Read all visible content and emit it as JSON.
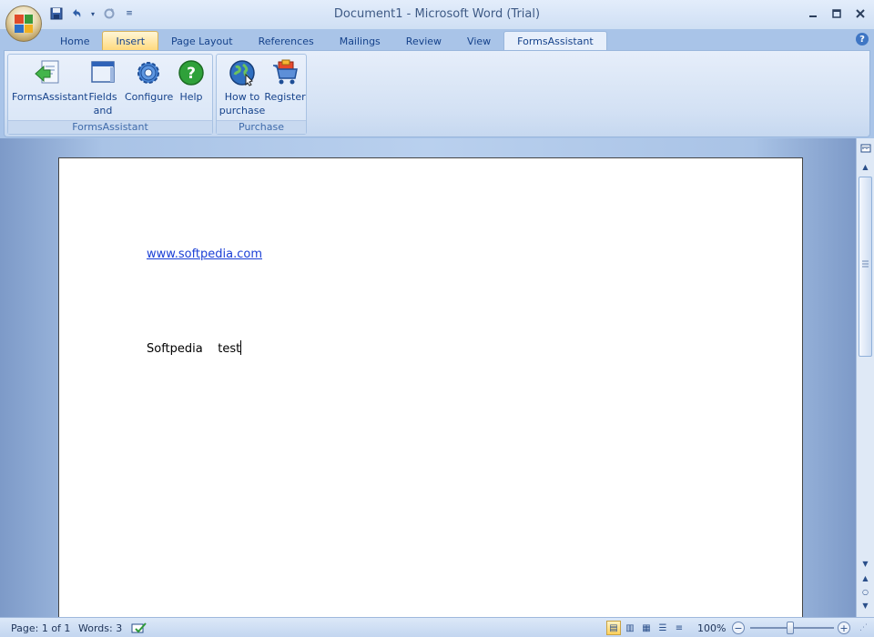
{
  "window": {
    "document_name": "Document1",
    "separator": "-",
    "app_name": "Microsoft Word (Trial)"
  },
  "quick_access": {
    "icons": [
      "save-icon",
      "undo-icon",
      "redo-icon",
      "customize-icon"
    ]
  },
  "tabs": [
    {
      "label": "Home"
    },
    {
      "label": "Insert"
    },
    {
      "label": "Page Layout"
    },
    {
      "label": "References"
    },
    {
      "label": "Mailings"
    },
    {
      "label": "Review"
    },
    {
      "label": "View"
    },
    {
      "label": "FormsAssistant"
    }
  ],
  "ribbon": {
    "groups": [
      {
        "label": "FormsAssistant",
        "buttons": [
          {
            "label": "FormsAssistant",
            "icon": "forms-assistant-icon"
          },
          {
            "label": "Fields and Clips",
            "icon": "fields-clips-icon"
          },
          {
            "label": "Configure",
            "icon": "gear-icon"
          },
          {
            "label": "Help",
            "icon": "help-icon"
          }
        ]
      },
      {
        "label": "Purchase",
        "buttons": [
          {
            "label": "How to purchase",
            "icon": "globe-icon"
          },
          {
            "label": "Register",
            "icon": "shopping-cart-icon"
          }
        ]
      }
    ]
  },
  "document": {
    "link": "www.softpedia.com",
    "text": "Softpedia    test"
  },
  "status": {
    "page": "Page: 1 of 1",
    "words": "Words: 3",
    "zoom": "100%"
  },
  "colors": {
    "accent": "#15428b",
    "link": "#1a3fd6",
    "active_view": "#ffd15a"
  }
}
